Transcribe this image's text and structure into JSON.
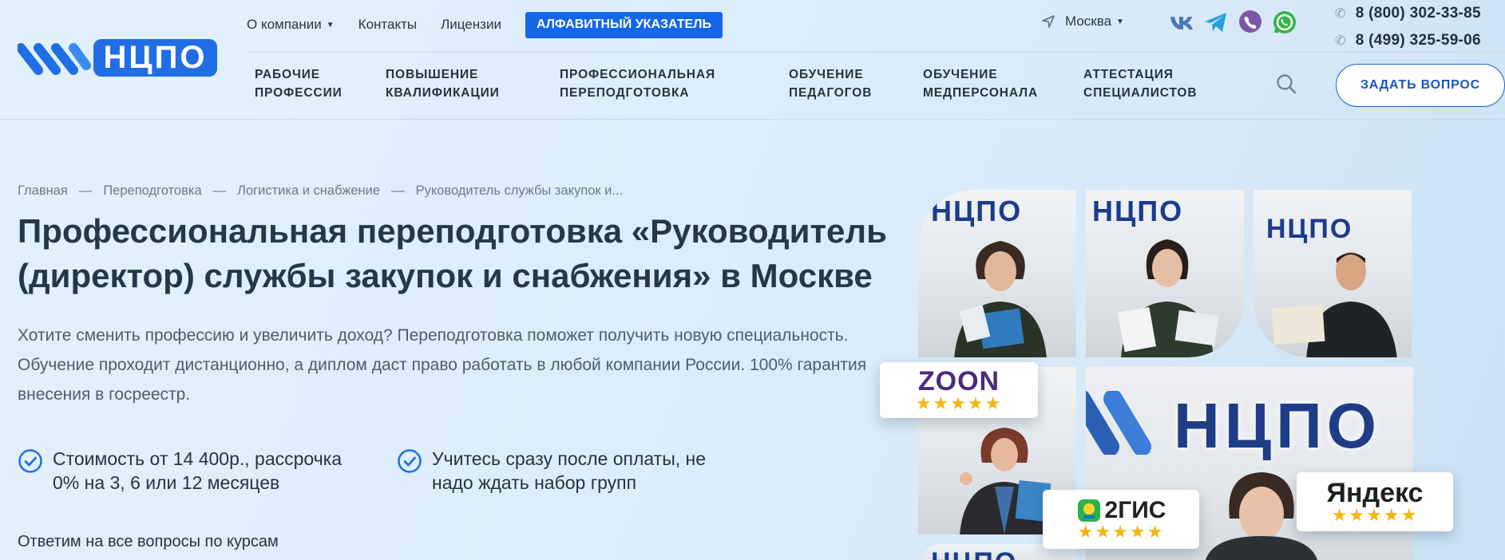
{
  "logo": {
    "text": "НЦПО"
  },
  "topnav": {
    "about": "О компании",
    "contacts": "Контакты",
    "licenses": "Лицензии",
    "alpha_index": "АЛФАВИТНЫЙ УКАЗАТЕЛЬ"
  },
  "city": "Москва",
  "socials": [
    "vk-icon",
    "telegram-icon",
    "viber-icon",
    "whatsapp-icon"
  ],
  "phones": [
    "8 (800) 302-33-85",
    "8 (499) 325-59-06"
  ],
  "mainnav": [
    {
      "line1": "РАБОЧИЕ",
      "line2": "ПРОФЕССИИ"
    },
    {
      "line1": "ПОВЫШЕНИЕ",
      "line2": "КВАЛИФИКАЦИИ"
    },
    {
      "line1": "ПРОФЕССИОНАЛЬНАЯ",
      "line2": "ПЕРЕПОДГОТОВКА"
    },
    {
      "line1": "ОБУЧЕНИЕ",
      "line2": "ПЕДАГОГОВ"
    },
    {
      "line1": "ОБУЧЕНИЕ",
      "line2": "МЕДПЕРСОНАЛА"
    },
    {
      "line1": "АТТЕСТАЦИЯ",
      "line2": "СПЕЦИАЛИСТОВ"
    }
  ],
  "ask_button": "ЗАДАТЬ ВОПРОС",
  "breadcrumbs": [
    "Главная",
    "Переподготовка",
    "Логистика и снабжение",
    "Руководитель службы закупок и..."
  ],
  "breadcrumb_sep": "—",
  "page_title": "Профессиональная переподготовка «Руководитель (директор) службы закупок и снабжения» в Москве",
  "lead": "Хотите сменить профессию и увеличить доход? Переподготовка поможет получить новую специальность. Обучение проходит дистанционно, а диплом даст право работать в любой компании России. 100% гарантия внесения в госреестр.",
  "features": [
    "Стоимость от 14 400р., рассрочка 0% на 3, 6 или 12 месяцев",
    "Учитесь сразу после оплаты, не надо ждать набор групп"
  ],
  "answer_text": "Ответим на все вопросы по курсам",
  "reviews": {
    "zoon": "ZOON",
    "gis": "2ГИС",
    "yandex": "Яндекс",
    "stars": "★★★★★"
  },
  "photo_brand": "НЦПО",
  "colors": {
    "accent": "#1466e8",
    "brand": "#1f6ee5",
    "title": "#23394a",
    "stars": "#f5b50f"
  }
}
